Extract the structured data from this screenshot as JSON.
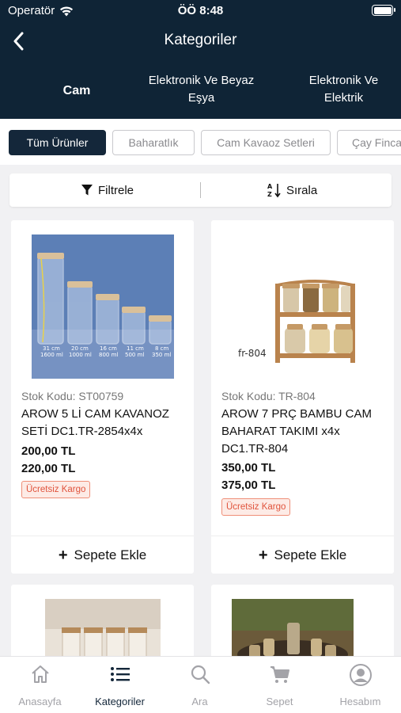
{
  "status": {
    "carrier": "Operatör",
    "time": "ÖÖ 8:48"
  },
  "header": {
    "title": "Kategoriler"
  },
  "tabs": [
    {
      "label": "Cam",
      "active": true
    },
    {
      "label": "Elektronik Ve Beyaz Eşya",
      "active": false
    },
    {
      "label": "Elektronik Ve Elektrik",
      "active": false
    }
  ],
  "chips": [
    {
      "label": "Tüm Ürünler",
      "active": true
    },
    {
      "label": "Baharatlık",
      "active": false
    },
    {
      "label": "Cam Kavaoz Setleri",
      "active": false
    },
    {
      "label": "Çay Finca",
      "active": false
    }
  ],
  "filterbar": {
    "filter_label": "Filtrele",
    "sort_label": "Sırala"
  },
  "products": [
    {
      "stock": "Stok Kodu: ST00759",
      "name": "AROW 5 Lİ CAM KAVANOZ SETİ DC1.TR-2854x4x",
      "price": "200,00 TL",
      "old_price": "220,00 TL",
      "badge": "Ücretsiz Kargo",
      "add_label": "Sepete Ekle",
      "image_labels": [
        "31 cm",
        "1600 ml",
        "20 cm",
        "1000 ml",
        "16 cm",
        "800 ml",
        "11 cm",
        "500 ml",
        "8 cm",
        "350 ml"
      ]
    },
    {
      "stock": "Stok Kodu: TR-804",
      "name": "AROW 7 PRÇ BAMBU CAM BAHARAT TAKIMI x4x DC1.TR-804",
      "price": "350,00 TL",
      "old_price": "375,00 TL",
      "badge": "Ücretsiz Kargo",
      "add_label": "Sepete Ekle",
      "image_labels": [
        "fr-804"
      ]
    }
  ],
  "bottom_nav": [
    {
      "label": "Anasayfa",
      "icon": "home-icon",
      "active": false
    },
    {
      "label": "Kategoriler",
      "icon": "list-icon",
      "active": true
    },
    {
      "label": "Ara",
      "icon": "search-icon",
      "active": false
    },
    {
      "label": "Sepet",
      "icon": "cart-icon",
      "active": false
    },
    {
      "label": "Hesabım",
      "icon": "account-icon",
      "active": false
    }
  ],
  "colors": {
    "header_bg": "#0f2436",
    "accent": "#14273a",
    "badge": "#e0533c"
  }
}
